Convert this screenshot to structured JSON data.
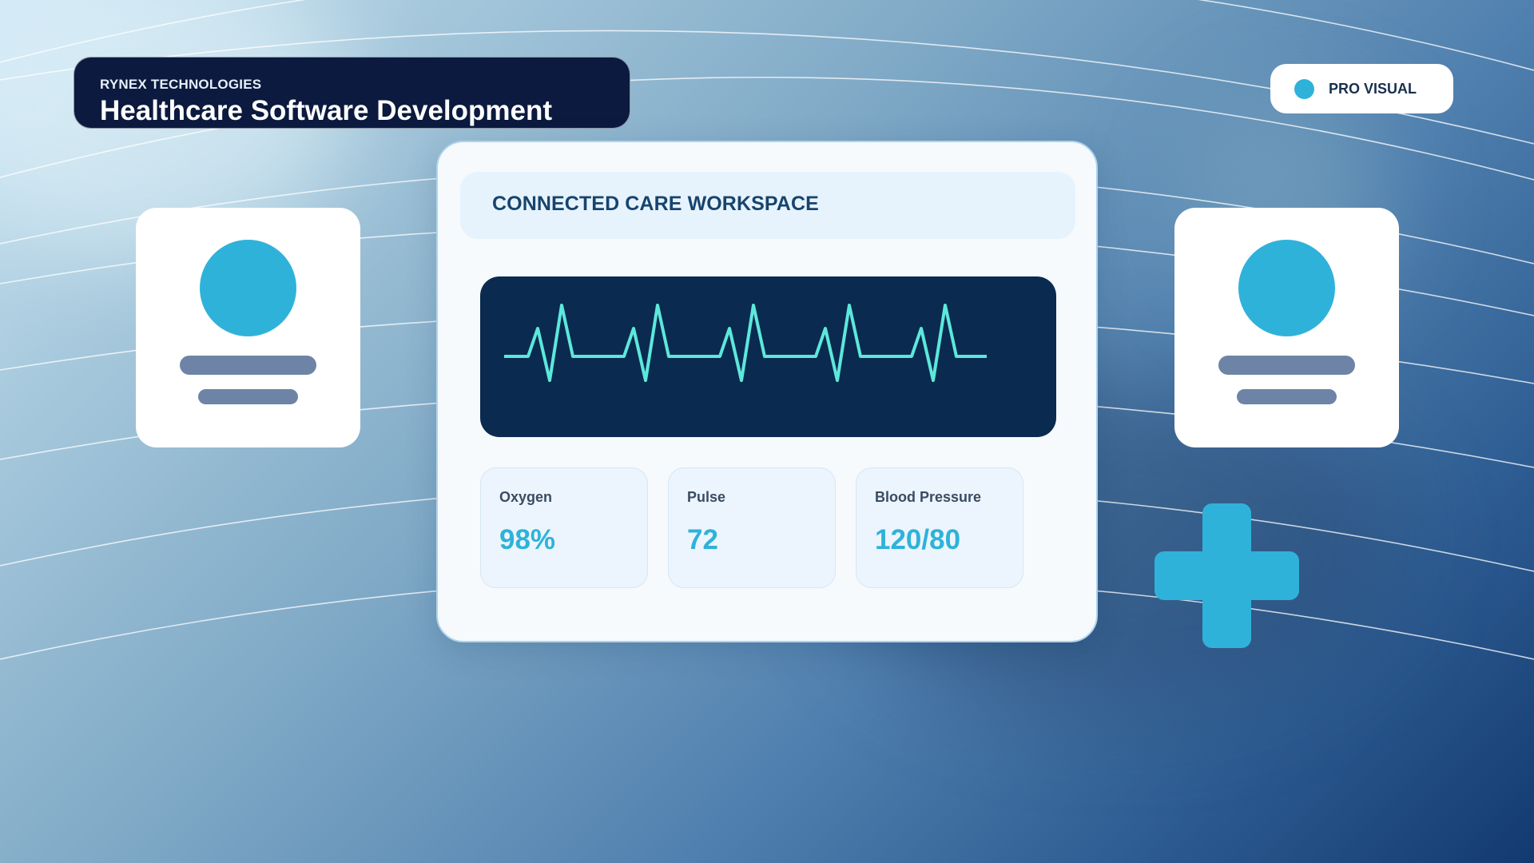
{
  "brand": {
    "company": "RYNEX TECHNOLOGIES",
    "title": "Healthcare Software Development"
  },
  "badge": {
    "label": "PRO VISUAL",
    "dot_color": "#2fb2da"
  },
  "workspace": {
    "title": "CONNECTED CARE WORKSPACE",
    "vitals": [
      {
        "label": "Oxygen",
        "value": "98%"
      },
      {
        "label": "Pulse",
        "value": "72"
      },
      {
        "label": "Blood Pressure",
        "value": "120/80"
      }
    ]
  },
  "colors": {
    "accent": "#2fb2da",
    "brand_navy": "#0b1a3e",
    "monitor_bg": "#0b2a4f",
    "ecg_trace": "#5ce8dc",
    "placeholder_line": "#6e84a6"
  },
  "icons": {
    "profile_left": "user-profile-card",
    "profile_right": "user-profile-card",
    "medical": "medical-cross-icon",
    "monitor": "heartbeat-ecg"
  }
}
